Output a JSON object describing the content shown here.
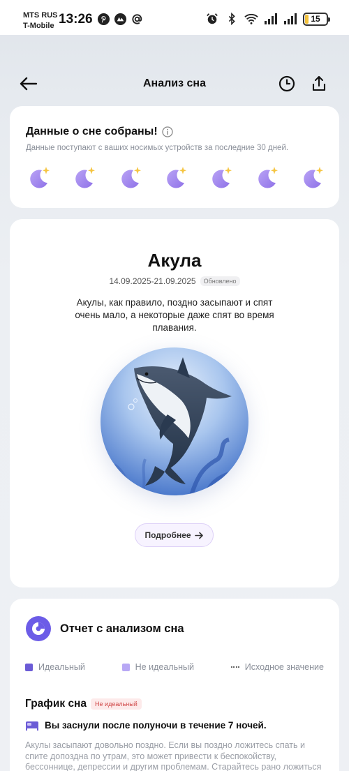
{
  "status_bar": {
    "carrier_line1": "MTS RUS",
    "carrier_line2": "T-Mobile",
    "time": "13:26",
    "battery": "15",
    "battery_level_percent": 15,
    "battery_color": "#f4c23b"
  },
  "header": {
    "title": "Анализ сна",
    "icons": [
      "arrow-left-icon",
      "history-clock-icon",
      "share-icon"
    ]
  },
  "data_card": {
    "title": "Данные о сне собраны!",
    "subtitle": "Данные поступают с ваших носимых устройств за последние 30 дней.",
    "moon_count": 7,
    "moon_color": "#8f72e8",
    "star_color": "#f5c542"
  },
  "animal_card": {
    "name": "Акула",
    "date_range": "14.09.2025-21.09.2025",
    "updated_label": "Обновлено",
    "description": "Акулы, как правило, поздно засыпают и спят очень мало, а некоторые даже спят во время плавания.",
    "more_button": "Подробнее",
    "image": "shark-illustration"
  },
  "report_card": {
    "title": "Отчет с анализом сна",
    "legend": {
      "ideal": "Идеальный",
      "non_ideal": "Не идеальный",
      "baseline": "Исходное значение"
    },
    "graph_title": "График сна",
    "graph_badge": "Не идеальный",
    "insight": "Вы заснули после полуночи в течение 7 ночей.",
    "insight_description": "Акулы засыпают довольно поздно. Если вы поздно ложитесь спать и спите допоздна по утрам, это может привести к беспокойству, бессоннице, депрессии и другим проблемам. Старайтесь рано ложиться спать и рано",
    "colors": {
      "ideal": "#6b5bd6",
      "non_ideal": "#b8a8f5",
      "accent": "#6c5ce7"
    }
  }
}
